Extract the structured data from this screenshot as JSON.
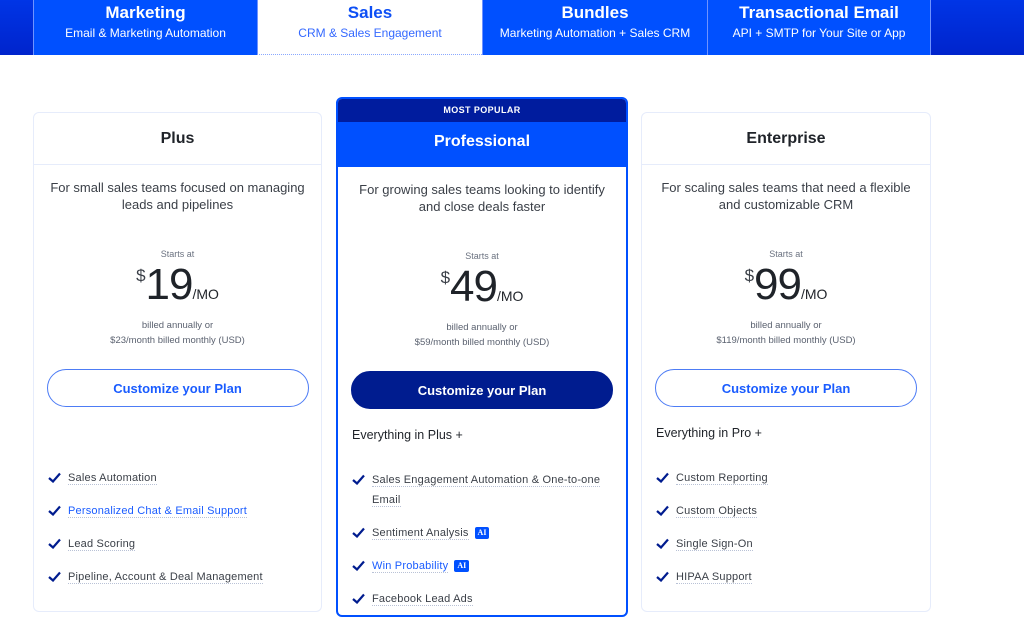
{
  "tabs": [
    {
      "title": "Marketing",
      "subtitle": "Email & Marketing Automation",
      "active": false
    },
    {
      "title": "Sales",
      "subtitle": "CRM & Sales Engagement",
      "active": true
    },
    {
      "title": "Bundles",
      "subtitle": "Marketing Automation + Sales CRM",
      "active": false
    },
    {
      "title": "Transactional Email",
      "subtitle": "API + SMTP for Your Site or App",
      "active": false
    }
  ],
  "colors": {
    "brand_blue": "#0050ff",
    "navy": "#001c8f",
    "link": "#1a5cff"
  },
  "plans": {
    "plus": {
      "name": "Plus",
      "description": "For small sales teams focused on managing leads and pipelines",
      "starts_at": "Starts at",
      "currency": "$",
      "price": "19",
      "period": "/MO",
      "billed_line1": "billed annually or",
      "billed_line2": "$23/month billed monthly (USD)",
      "cta": "Customize your Plan",
      "features": [
        {
          "label": "Sales Automation",
          "icon": "check-icon"
        },
        {
          "label": "Personalized Chat & Email Support",
          "icon": "check-icon",
          "link": true
        },
        {
          "label": "Lead Scoring",
          "icon": "check-icon"
        },
        {
          "label": "Pipeline, Account & Deal Management",
          "icon": "check-icon"
        }
      ]
    },
    "professional": {
      "badge": "MOST POPULAR",
      "name": "Professional",
      "description": "For growing sales teams looking to identify and close deals faster",
      "starts_at": "Starts at",
      "currency": "$",
      "price": "49",
      "period": "/MO",
      "billed_line1": "billed annually or",
      "billed_line2": "$59/month billed monthly (USD)",
      "cta": "Customize your Plan",
      "everything": "Everything in Plus +",
      "features": [
        {
          "label": "Sales Engagement Automation & One-to-one Email",
          "icon": "check-icon"
        },
        {
          "label": "Sentiment Analysis",
          "icon": "check-icon",
          "badge": "AI"
        },
        {
          "label": "Win Probability",
          "icon": "check-icon",
          "badge": "AI",
          "link": true
        },
        {
          "label": "Facebook Lead Ads",
          "icon": "check-icon"
        }
      ]
    },
    "enterprise": {
      "name": "Enterprise",
      "description": "For scaling sales teams that need a flexible and customizable CRM",
      "starts_at": "Starts at",
      "currency": "$",
      "price": "99",
      "period": "/MO",
      "billed_line1": "billed annually or",
      "billed_line2": "$119/month billed monthly (USD)",
      "cta": "Customize your Plan",
      "everything": "Everything in Pro +",
      "features": [
        {
          "label": "Custom Reporting",
          "icon": "check-icon"
        },
        {
          "label": "Custom Objects",
          "icon": "check-icon"
        },
        {
          "label": "Single Sign-On",
          "icon": "check-icon"
        },
        {
          "label": "HIPAA Support",
          "icon": "check-icon"
        }
      ]
    }
  }
}
